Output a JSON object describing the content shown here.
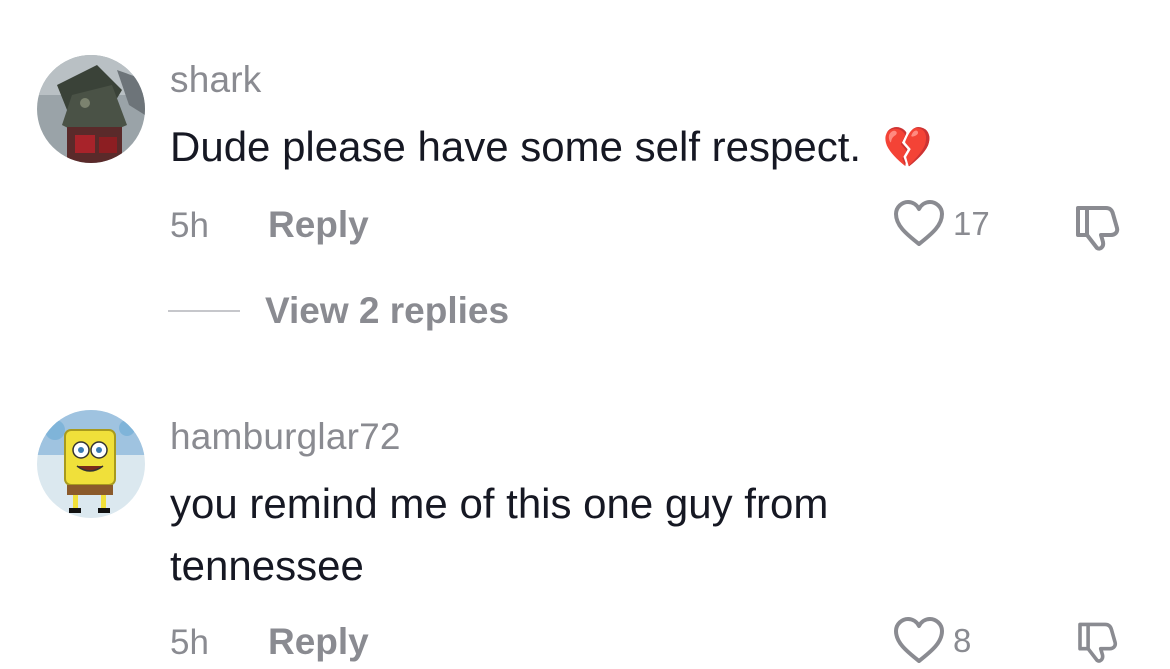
{
  "comments": [
    {
      "username": "shark",
      "text": "Dude please have some self respect.",
      "emoji": "💔",
      "time": "5h",
      "reply_label": "Reply",
      "likes": "17",
      "view_replies_label": "View 2 replies",
      "avatar_icon": "robot-mech-avatar"
    },
    {
      "username": "hamburglar72",
      "text": "you remind me of this one guy from tennessee",
      "time": "5h",
      "reply_label": "Reply",
      "likes": "8",
      "avatar_icon": "sponge-character-avatar"
    }
  ],
  "colors": {
    "primary_text": "#161823",
    "secondary_text": "#8a8b91",
    "divider": "#c6c7cb"
  }
}
